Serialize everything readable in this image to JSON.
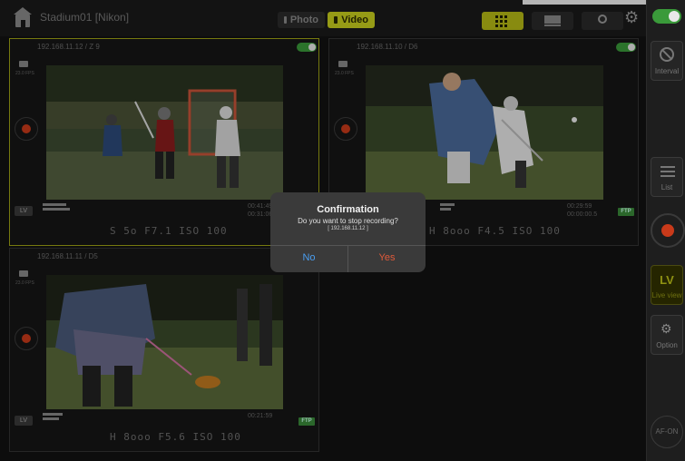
{
  "header": {
    "title": "Stadium01 [Nikon]",
    "photo_label": "Photo",
    "video_label": "Video",
    "accent": "#c9cf1e"
  },
  "sidebar": {
    "interval_label": "Interval",
    "list_label": "List",
    "lv_big": "LV",
    "lv_label": "Live view",
    "option_label": "Option",
    "afon_label": "AF-ON"
  },
  "cameras": [
    {
      "ip": "192.168.11.12 / Z 9",
      "fps": "23.0 FPS",
      "lv": "LV",
      "time_top": "00:41:49",
      "time_bottom": "00:31:06",
      "exif": "S   5o F7.1 ISO 100",
      "selected": true
    },
    {
      "ip": "192.168.11.10 / D6",
      "fps": "23.0 FPS",
      "time_top": "00:29:59",
      "time_bottom": "00:00:00.5",
      "ftp": "FTP",
      "exif": "H  8ooo F4.5 ISO 100"
    },
    {
      "ip": "192.168.11.11 / D5",
      "fps": "23.0 FPS",
      "lv": "LV",
      "time_top": "00:21:59",
      "ftp": "FTP",
      "exif": "H  8ooo F5.6 ISO 100"
    }
  ],
  "dialog": {
    "title": "Confirmation",
    "message": "Do you want to stop recording?",
    "ip": "[ 192.168.11.12 ]",
    "no_label": "No",
    "yes_label": "Yes"
  }
}
